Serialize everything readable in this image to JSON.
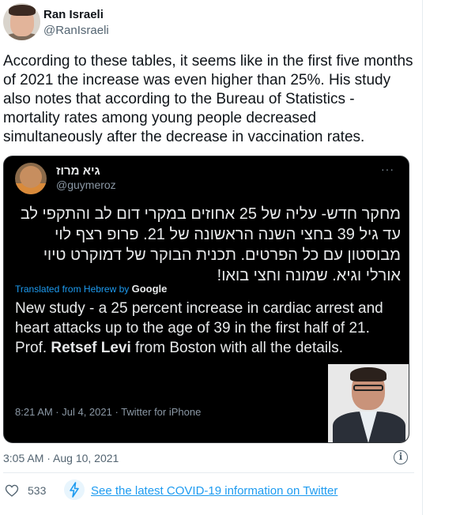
{
  "tweet": {
    "author_name": "Ran Israeli",
    "author_handle": "@RanIsraeli",
    "text": "According to these tables, it seems like in the first five months of 2021 the increase was even higher than 25%. His study also notes that according to the Bureau of Statistics - mortality rates among young people decreased simultaneously after the decrease in vaccination rates.",
    "timestamp": "3:05 AM · Aug 10, 2021",
    "like_count": "533",
    "covid_link": "See the latest COVID-19 information on Twitter"
  },
  "quoted_tweet": {
    "author_name": "גיא מרוז",
    "author_handle": "@guymeroz",
    "more": "···",
    "hebrew_text": "מחקר חדש- עליה של 25 אחוזים במקרי דום לב והתקפי לב עד גיל 39 בחצי השנה הראשונה של 21. פרופ רצף לוי מבוסטון עם כל הפרטים. תכנית הבוקר של דמוקרט טיוי אורלי וגיא. שמונה וחצי בואו!",
    "translated_label": "Translated from Hebrew by",
    "translated_by": "Google",
    "english_text_before": "New study - a 25 percent increase in cardiac arrest and heart attacks up to the age of 39 in the first half of 21. Prof. ",
    "english_bold": "Retsef Levi",
    "english_text_after": " from Boston with all the details.",
    "meta": "8:21 AM · Jul 4, 2021 · Twitter for iPhone"
  },
  "icons": {
    "info": "i",
    "heart": "heart-icon",
    "bolt": "bolt-icon"
  },
  "colors": {
    "link": "#1d9bf0",
    "secondary_text": "#536471",
    "quote_bg": "#000000"
  }
}
